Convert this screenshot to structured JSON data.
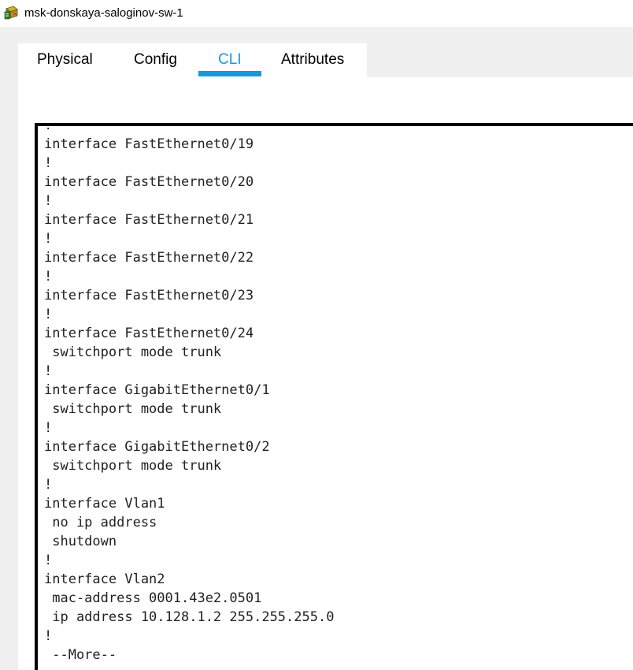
{
  "window": {
    "title": "msk-donskaya-saloginov-sw-1",
    "icon": "packet-tracer-switch-icon"
  },
  "tabs": [
    {
      "label": "Physical",
      "active": false
    },
    {
      "label": "Config",
      "active": false
    },
    {
      "label": "CLI",
      "active": true
    },
    {
      "label": "Attributes",
      "active": false
    }
  ],
  "colors": {
    "accent": "#1a97d6",
    "cli_border": "#000000"
  },
  "cli": {
    "lines": [
      "!",
      "interface FastEthernet0/19",
      "!",
      "interface FastEthernet0/20",
      "!",
      "interface FastEthernet0/21",
      "!",
      "interface FastEthernet0/22",
      "!",
      "interface FastEthernet0/23",
      "!",
      "interface FastEthernet0/24",
      " switchport mode trunk",
      "!",
      "interface GigabitEthernet0/1",
      " switchport mode trunk",
      "!",
      "interface GigabitEthernet0/2",
      " switchport mode trunk",
      "!",
      "interface Vlan1",
      " no ip address",
      " shutdown",
      "!",
      "interface Vlan2",
      " mac-address 0001.43e2.0501",
      " ip address 10.128.1.2 255.255.255.0",
      "!",
      " --More--"
    ]
  }
}
